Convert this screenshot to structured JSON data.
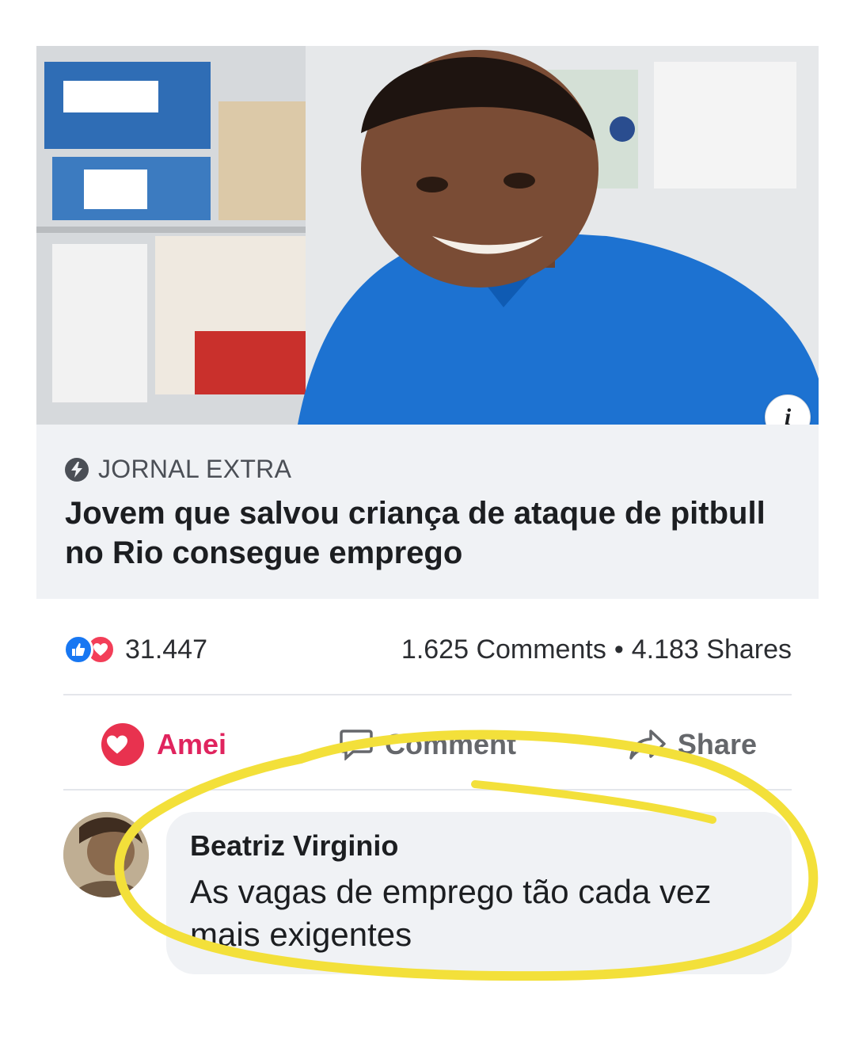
{
  "link_preview": {
    "source_name": "JORNAL EXTRA",
    "headline": "Jovem que salvou criança de ataque de pitbull no Rio consegue emprego",
    "info_icon": "info-icon",
    "info_glyph": "i"
  },
  "engagement": {
    "reaction_count": "31.447",
    "comments": "1.625 Comments",
    "separator": "•",
    "shares": "4.183 Shares"
  },
  "actions": {
    "amei": "Amei",
    "comment": "Comment",
    "share": "Share"
  },
  "comment": {
    "author": "Beatriz Virginio",
    "text": "As vagas de emprego tão cada vez mais exigentes"
  },
  "colors": {
    "like_blue": "#1877f2",
    "love_red": "#f33e58",
    "highlight_yellow": "#f3e03a"
  }
}
